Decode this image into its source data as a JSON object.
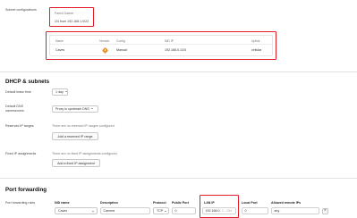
{
  "subnet": {
    "label": "Subnet configurations",
    "parent_subnet_label": "Parent Subnet",
    "parent_subnet_value": "/24 from 192.168.1.0/22",
    "table": {
      "headers": [
        "Name",
        "Version",
        "Config",
        "NID IP",
        "Uplink"
      ],
      "row": {
        "name": "Caves",
        "config": "Manual",
        "ip": "192.168.0.1/24",
        "uplink": "cellular"
      }
    }
  },
  "dhcp": {
    "title": "DHCP & subnets",
    "lease_label": "Default lease time",
    "lease_value": "1 day",
    "dns_label_line1": "Default DNS",
    "dns_label_line2": "nameservers",
    "dns_value": "Proxy to upstream DNS",
    "reserved_label": "Reserved IP ranges",
    "reserved_empty": "There are no reserved IP ranges configured.",
    "reserved_button": "Add a reserved IP range",
    "fixed_label": "Fixed IP assignments",
    "fixed_empty": "There are no fixed IP assignments configured.",
    "fixed_button": "Add a fixed IP assignment"
  },
  "port_forwarding": {
    "title": "Port forwarding",
    "rules_label": "Port forwarding rules",
    "headers": {
      "nid_name": "NID name",
      "description": "Description",
      "protocol": "Protocol",
      "public_port": "Public Port",
      "lan_ip": "LAN IP",
      "local_port": "Local Port",
      "allowed_remote_ips": "Allowed remote IPs"
    },
    "row": {
      "nid_name": "Caves",
      "description": "Camera",
      "protocol": "TCP",
      "public_port": "0",
      "lan_ip_prefix": "192.168.0.",
      "lan_ip_hint": "2 - 254",
      "local_port": "0",
      "allowed_remote_ips": "any"
    }
  },
  "colors": {
    "highlight": "#e11d2a",
    "router_icon": "#e7922e"
  }
}
